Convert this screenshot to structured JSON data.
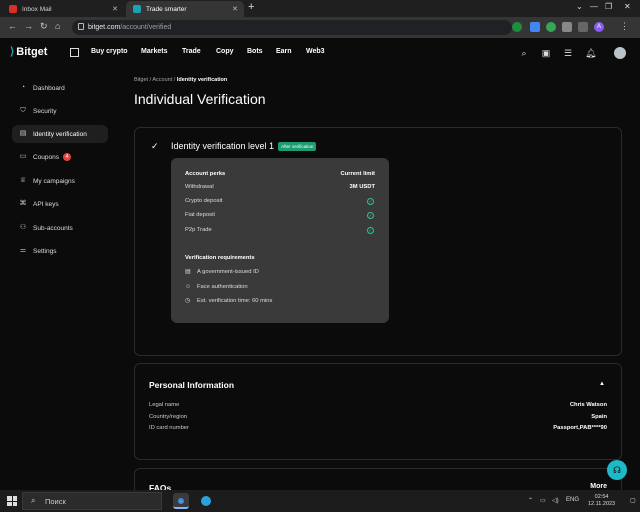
{
  "browser": {
    "tabs": [
      {
        "title": "Inbox Mail",
        "favicon_color": "#d93025"
      },
      {
        "title": "Trade smarter",
        "favicon_color": "#1da2b4"
      }
    ],
    "url_domain": "bitget.com",
    "url_path": "/account/verified",
    "profile_initial": "A"
  },
  "header": {
    "logo": "Bitget",
    "menu": [
      "Buy crypto",
      "Markets",
      "Trade",
      "Copy",
      "Bots",
      "Earn",
      "Web3"
    ]
  },
  "sidebar": {
    "items": [
      {
        "label": "Dashboard",
        "icon": "gauge-icon"
      },
      {
        "label": "Security",
        "icon": "shield-icon"
      },
      {
        "label": "Identity verification",
        "icon": "id-card-icon",
        "active": true
      },
      {
        "label": "Coupons",
        "icon": "ticket-icon",
        "badge": "4"
      },
      {
        "label": "My campaigns",
        "icon": "trophy-icon"
      },
      {
        "label": "API keys",
        "icon": "api-icon"
      },
      {
        "label": "Sub-accounts",
        "icon": "users-icon"
      },
      {
        "label": "Settings",
        "icon": "sliders-icon"
      }
    ]
  },
  "breadcrumb": {
    "root": "Bitget",
    "sep": "/",
    "mid": "Account",
    "current": "Identity verification"
  },
  "page": {
    "title": "Individual Verification"
  },
  "verification": {
    "level_title": "Identity verification level 1",
    "badge": "After verification",
    "perks_header": "Account perks",
    "limit_header": "Current limit",
    "perks": [
      {
        "label": "Withdrawal",
        "value": "3M USDT"
      },
      {
        "label": "Crypto deposit",
        "value": "check"
      },
      {
        "label": "Fiat deposit",
        "value": "check"
      },
      {
        "label": "P2p Trade",
        "value": "check"
      }
    ],
    "req_title": "Verification requirements",
    "requirements": [
      {
        "label": "A government-issued ID",
        "icon": "id-card-icon"
      },
      {
        "label": "Face authentication",
        "icon": "person-icon"
      },
      {
        "label": "Est. verification time: 60 mins",
        "icon": "clock-icon"
      }
    ]
  },
  "personal_info": {
    "title": "Personal Information",
    "rows": [
      {
        "label": "Legal name",
        "value": "Chris Watson"
      },
      {
        "label": "Country/region",
        "value": "Spain"
      },
      {
        "label": "ID card number",
        "value": "Passport,PAB****90"
      }
    ]
  },
  "faq": {
    "title": "FAQs",
    "more": "More"
  },
  "taskbar": {
    "search_placeholder": "Поиск",
    "lang": "ENG",
    "time": "02:54",
    "date": "12.11.2023"
  },
  "colors": {
    "accent": "#1da2b4",
    "success": "#1d9c6f",
    "danger": "#e0463f"
  }
}
